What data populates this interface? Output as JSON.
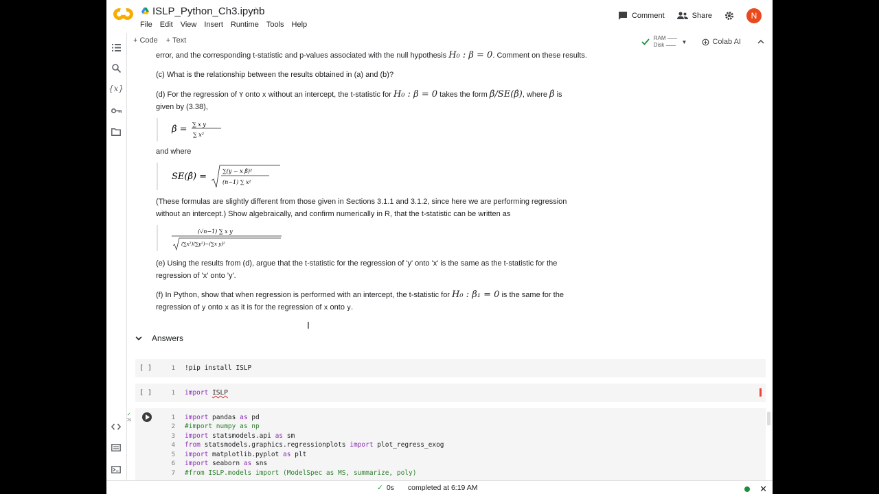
{
  "header": {
    "title": "ISLP_Python_Ch3.ipynb",
    "menu": [
      "File",
      "Edit",
      "View",
      "Insert",
      "Runtime",
      "Tools",
      "Help"
    ],
    "comment_label": "Comment",
    "share_label": "Share",
    "avatar_letter": "N"
  },
  "toolbar": {
    "code_label": "+ Code",
    "text_label": "+ Text",
    "ram_label": "RAM",
    "disk_label": "Disk",
    "colab_ai_label": "Colab AI"
  },
  "markdown": {
    "line_a": "error, and the corresponding t-statistic and p-values associated with the null hypothesis",
    "line_a_math": "H₀ : β = 0",
    "line_a_end": ". Comment on these results.",
    "q_c": "(c) What is the relationship between the results obtained in (a) and (b)?",
    "q_d_1": "(d) For the regression of",
    "q_d_Y": "Y",
    "q_d_onto": "onto",
    "q_d_x": "x",
    "q_d_2": "without an intercept, the t-statistic for",
    "q_d_math1": "H₀ : β = 0",
    "q_d_3": "takes the form",
    "q_d_math2": "β̂/SE(β̂)",
    "q_d_4": ", where",
    "q_d_math3": "β̂",
    "q_d_5": "is",
    "q_d_6": "given by (3.38),",
    "and_where": "and where",
    "para_1": "(These formulas are slightly different from those given in Sections 3.1.1 and 3.1.2, since here we are performing regression",
    "para_2": "without an intercept.) Show algebraically, and confirm numerically in R, that the t-statistic can be written as",
    "q_e_1": "(e) Using the results from (d), argue that the t-statistic for the regression of 'y' onto 'x' is the same as the t-statistic for the",
    "q_e_2": "regression of 'x' onto 'y'.",
    "q_f_1": "(f) In Python, show that when regression is performed with an intercept, the t-statistic for",
    "q_f_math": "H₀ : β₁ = 0",
    "q_f_2": "is the same for the",
    "q_f_3a": "regression of",
    "q_f_y1": "y",
    "q_f_onto1": "onto",
    "q_f_x1": "x",
    "q_f_3b": "as it is for the regression of",
    "q_f_x2": "x",
    "q_f_onto2": "onto",
    "q_f_y2": "y",
    "q_f_end": "."
  },
  "answers_heading": "Answers",
  "cells": {
    "cell1": {
      "gutter": "[ ]",
      "line": "1",
      "code": "!pip install ISLP"
    },
    "cell2": {
      "gutter": "[ ]",
      "line": "1",
      "code_kw": "import",
      "code_mod": "ISLP"
    },
    "cell3": {
      "exec_time": "0s",
      "lines": [
        "1",
        "2",
        "3",
        "4",
        "5",
        "6",
        "7"
      ]
    }
  },
  "status": {
    "time": "0s",
    "completed": "completed at 6:19 AM"
  }
}
